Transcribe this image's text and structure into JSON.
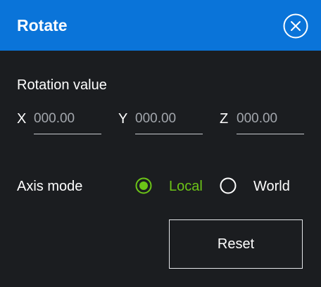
{
  "dialog": {
    "title": "Rotate",
    "accent_color": "#0a74d9",
    "background_color": "#1b1d20",
    "close_icon": "close-circle-icon"
  },
  "rotation": {
    "label": "Rotation value",
    "x": {
      "label": "X",
      "value": "",
      "placeholder": "000.00"
    },
    "y": {
      "label": "Y",
      "value": "",
      "placeholder": "000.00"
    },
    "z": {
      "label": "Z",
      "value": "",
      "placeholder": "000.00"
    }
  },
  "axis_mode": {
    "label": "Axis mode",
    "selected": "Local",
    "selected_color": "#6cc417",
    "options": [
      {
        "label": "Local",
        "selected": true
      },
      {
        "label": "World",
        "selected": false
      }
    ]
  },
  "actions": {
    "reset_label": "Reset"
  }
}
